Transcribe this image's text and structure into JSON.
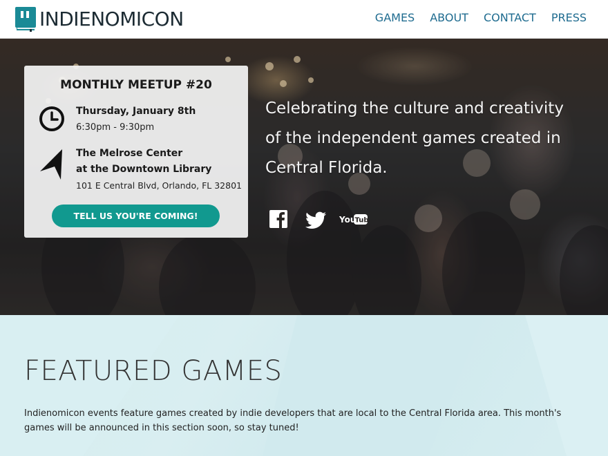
{
  "header": {
    "logo_text": "INDIENOMICON",
    "nav": [
      "GAMES",
      "ABOUT",
      "CONTACT",
      "PRESS"
    ]
  },
  "hero": {
    "card": {
      "title": "MONTHLY MEETUP #20",
      "date": "Thursday, January 8th",
      "time": "6:30pm - 9:30pm",
      "venue_name": "The Melrose Center",
      "venue_sub": "at the Downtown Library",
      "venue_address": "101 E Central Blvd, Orlando, FL 32801",
      "rsvp_label": "TELL US YOU'RE COMING!",
      "icons": [
        "clock-icon",
        "location-arrow-icon"
      ]
    },
    "tagline": "Celebrating the culture and creativity of the independent games created in Central Florida.",
    "social": [
      {
        "name": "facebook-icon"
      },
      {
        "name": "twitter-icon"
      },
      {
        "name": "youtube-icon",
        "label_you": "You",
        "label_tube": "Tube"
      }
    ]
  },
  "featured": {
    "title": "FEATURED GAMES",
    "text": "Indienomicon events feature games created by indie developers that are local to the Central Florida area. This month's games will be announced in this section soon, so stay tuned!"
  },
  "colors": {
    "nav": "#1e6b8f",
    "logo_mark": "#1a8a96",
    "button": "#11998f",
    "featured_bg": "#d4ecef"
  }
}
